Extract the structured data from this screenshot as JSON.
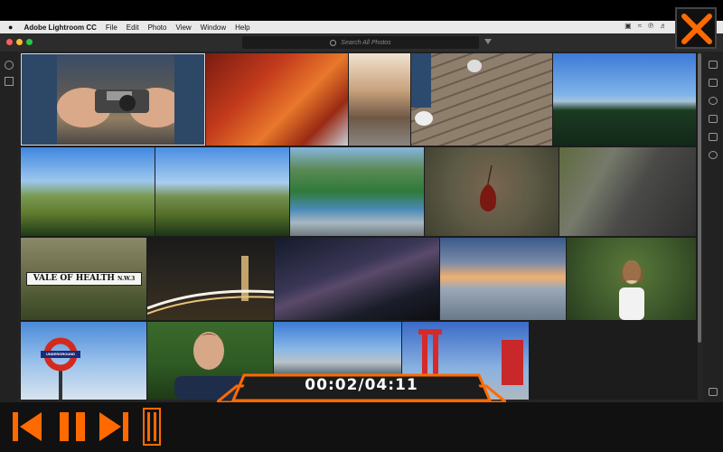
{
  "menubar": {
    "app_name": "Adobe Lightroom CC",
    "items": [
      "File",
      "Edit",
      "Photo",
      "View",
      "Window",
      "Help"
    ],
    "status_icons": [
      "display-icon",
      "wifi-icon",
      "bluetooth-icon",
      "volume-icon"
    ]
  },
  "window": {
    "traffic_colors": [
      "#fe5f57",
      "#febc2e",
      "#28c840"
    ],
    "search": {
      "placeholder": "Search All Photos"
    }
  },
  "left_tools": [
    "add-photos-icon",
    "library-icon"
  ],
  "right_tools": [
    "edit-sliders-icon",
    "crop-icon",
    "healing-icon",
    "brush-icon",
    "gradient-icon",
    "radial-icon",
    "tag-icon"
  ],
  "photos": [
    {
      "name": "camera-hands",
      "row": 0,
      "selected": true
    },
    {
      "name": "red-ivy",
      "row": 0
    },
    {
      "name": "alley-street",
      "row": 0
    },
    {
      "name": "wooden-deck-feet",
      "row": 0
    },
    {
      "name": "forest-mountains",
      "row": 0
    },
    {
      "name": "green-hill-1",
      "row": 1
    },
    {
      "name": "green-hill-2",
      "row": 1
    },
    {
      "name": "river-forest",
      "row": 1
    },
    {
      "name": "autumn-leaf",
      "row": 1
    },
    {
      "name": "stone-wall-road",
      "row": 1
    },
    {
      "name": "vale-of-health-sign",
      "row": 2
    },
    {
      "name": "big-ben-night",
      "row": 2
    },
    {
      "name": "milky-way",
      "row": 2
    },
    {
      "name": "beach-sunset",
      "row": 2
    },
    {
      "name": "girl-portrait",
      "row": 2
    },
    {
      "name": "underground-sign",
      "row": 3
    },
    {
      "name": "man-portrait",
      "row": 3
    },
    {
      "name": "half-dome",
      "row": 3
    },
    {
      "name": "red-tower",
      "row": 3
    }
  ],
  "sign_text": {
    "vale": "VALE OF HEALTH",
    "vale_suffix": "N.W.3",
    "underground": "UNDERGROUND"
  },
  "player": {
    "timecode": "00:02/04:11",
    "accent": "#ff6a00",
    "buttons": [
      "skip-back",
      "pause",
      "skip-forward",
      "bookmark"
    ]
  }
}
